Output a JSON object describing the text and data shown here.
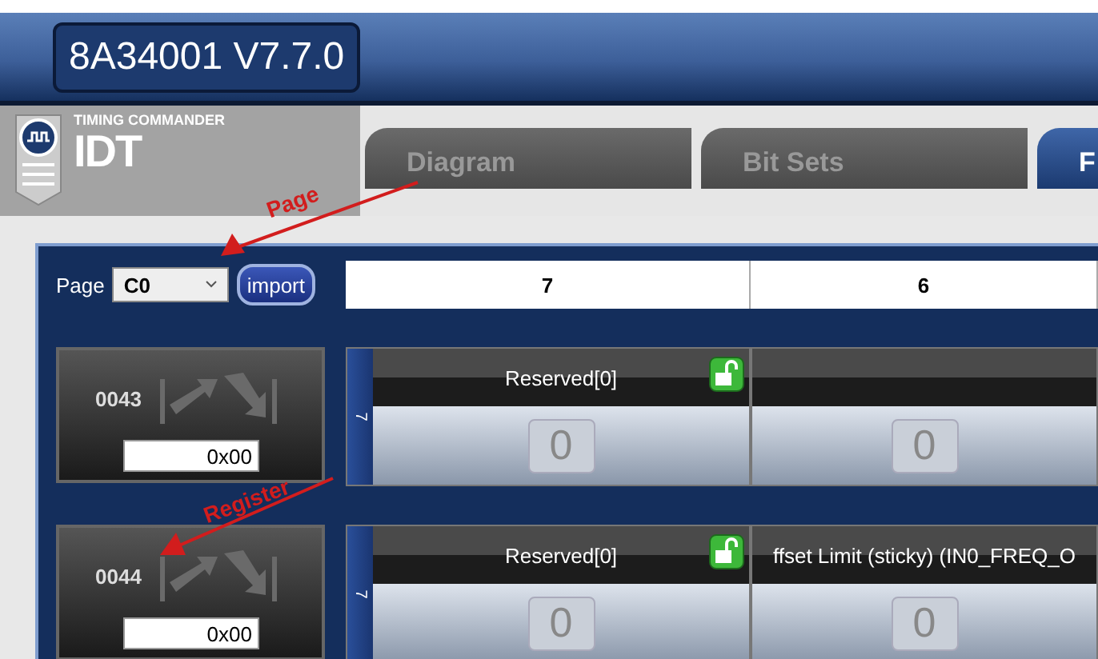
{
  "title": "8A34001 V7.7.0",
  "brand": {
    "caption": "TIMING COMMANDER",
    "logo": "IDT"
  },
  "tabs": [
    {
      "label": "Diagram",
      "selected": false
    },
    {
      "label": "Bit Sets",
      "selected": false
    },
    {
      "label": "F",
      "selected": true
    }
  ],
  "page_select": {
    "label": "Page",
    "value": "C0"
  },
  "import_button": "import",
  "columns": [
    "7",
    "6"
  ],
  "registers": [
    {
      "address": "0043",
      "value": "0x00",
      "bits": [
        {
          "index": "7",
          "name": "Reserved[0]",
          "locked": false,
          "value": "0"
        },
        {
          "value": "0"
        }
      ]
    },
    {
      "address": "0044",
      "value": "0x00",
      "bits": [
        {
          "index": "7",
          "name": "Reserved[0]",
          "locked": false,
          "value": "0"
        },
        {
          "name": "ffset Limit (sticky) (IN0_FREQ_O",
          "value": "0"
        }
      ]
    }
  ],
  "annotations": [
    {
      "text": "Page"
    },
    {
      "text": "Register"
    }
  ]
}
